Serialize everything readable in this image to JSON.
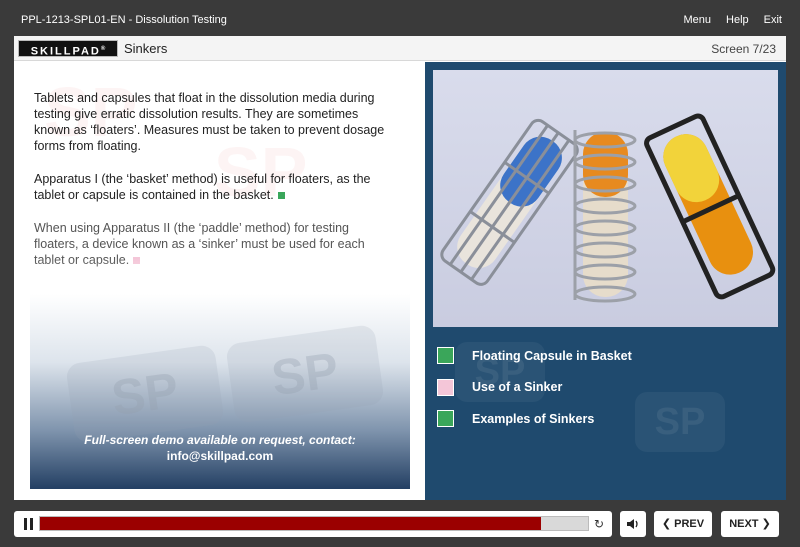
{
  "titlebar": {
    "title": "PPL-1213-SPL01-EN - Dissolution Testing",
    "menu": "Menu",
    "help": "Help",
    "exit": "Exit"
  },
  "header": {
    "logo": "SKILLPAD",
    "logo_tm": "®",
    "section_title": "Sinkers",
    "screen_count": "Screen 7/23"
  },
  "content": {
    "para1": "Tablets and capsules that float in the dissolution media during testing give erratic dissolution results. They are sometimes known as ‘floaters’. Measures must be taken to prevent dosage forms from floating.",
    "para2": "Apparatus I (the ‘basket’ method) is useful for floaters, as the tablet or capsule is contained in the basket.",
    "para3": "When using Apparatus II (the ‘paddle’ method) for testing floaters, a device known as a ‘sinker’ must be used for each tablet or capsule.",
    "demo_line1": "Full-screen demo available on request, contact:",
    "demo_line2": "info@skillpad.com",
    "watermark": "SP"
  },
  "legend": [
    {
      "label": "Floating Capsule in Basket",
      "color": "#3aa65a"
    },
    {
      "label": "Use of a Sinker",
      "color": "#f4c6d8"
    },
    {
      "label": "Examples of Sinkers",
      "color": "#3aa65a"
    }
  ],
  "controls": {
    "progress": 0.915,
    "prev": "❮ PREV",
    "next": "NEXT ❯"
  },
  "colors": {
    "accent_red": "#9b0000",
    "panel_blue": "#1f4a6e"
  }
}
